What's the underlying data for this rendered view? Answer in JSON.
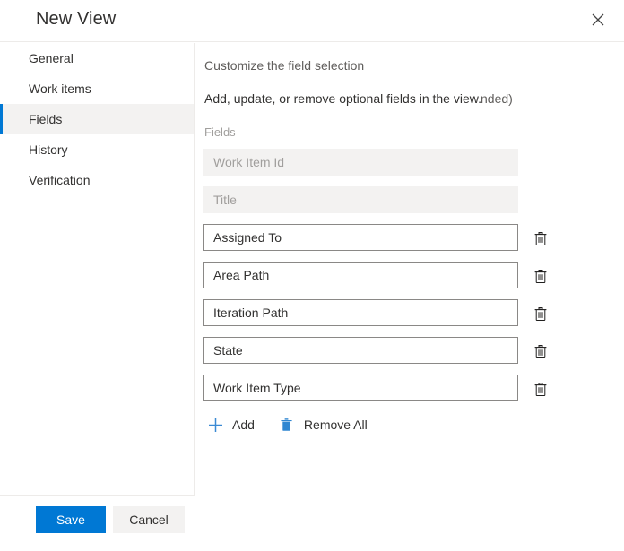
{
  "dialog": {
    "title": "New View",
    "close_icon": "close-icon"
  },
  "nav": {
    "items": [
      {
        "label": "General",
        "selected": false
      },
      {
        "label": "Work items",
        "selected": false
      },
      {
        "label": "Fields",
        "selected": true
      },
      {
        "label": "History",
        "selected": false
      },
      {
        "label": "Verification",
        "selected": false
      }
    ]
  },
  "content": {
    "heading": "Customize the field selection",
    "description": "Add, update, or remove optional fields in the view.",
    "clipped_note": "nded)",
    "fields_label": "Fields",
    "fields": [
      {
        "value": "Work Item Id",
        "readonly": true,
        "deletable": false
      },
      {
        "value": "Title",
        "readonly": true,
        "deletable": false
      },
      {
        "value": "Assigned To",
        "readonly": false,
        "deletable": true
      },
      {
        "value": "Area Path",
        "readonly": false,
        "deletable": true
      },
      {
        "value": "Iteration Path",
        "readonly": false,
        "deletable": true
      },
      {
        "value": "State",
        "readonly": false,
        "deletable": true
      },
      {
        "value": "Work Item Type",
        "readonly": false,
        "deletable": true
      }
    ],
    "delete_icon": "trash-icon",
    "actions": {
      "add_label": "Add",
      "add_icon": "plus-icon",
      "remove_all_label": "Remove All",
      "remove_all_icon": "trash-filled-icon"
    }
  },
  "footer": {
    "save_label": "Save",
    "cancel_label": "Cancel"
  },
  "colors": {
    "accent": "#0078d4",
    "selected_nav_background": "#f3f2f1",
    "readonly_field_background": "#f3f2f1",
    "field_border": "#8a8886",
    "divider": "#edebe9",
    "text_primary": "#323130",
    "text_secondary": "#605e5c",
    "text_disabled": "#a19f9d"
  }
}
